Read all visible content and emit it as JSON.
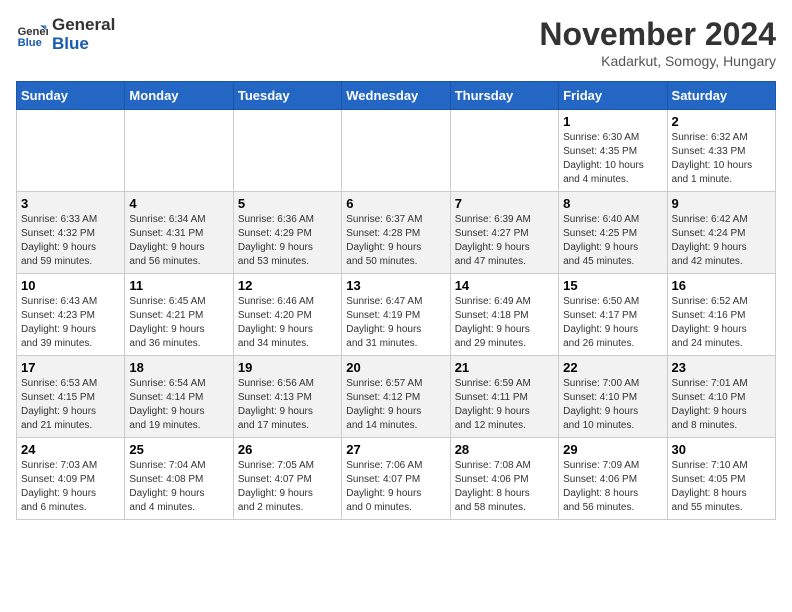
{
  "logo": {
    "line1": "General",
    "line2": "Blue"
  },
  "title": "November 2024",
  "subtitle": "Kadarkut, Somogy, Hungary",
  "headers": [
    "Sunday",
    "Monday",
    "Tuesday",
    "Wednesday",
    "Thursday",
    "Friday",
    "Saturday"
  ],
  "weeks": [
    [
      {
        "day": "",
        "detail": ""
      },
      {
        "day": "",
        "detail": ""
      },
      {
        "day": "",
        "detail": ""
      },
      {
        "day": "",
        "detail": ""
      },
      {
        "day": "",
        "detail": ""
      },
      {
        "day": "1",
        "detail": "Sunrise: 6:30 AM\nSunset: 4:35 PM\nDaylight: 10 hours\nand 4 minutes."
      },
      {
        "day": "2",
        "detail": "Sunrise: 6:32 AM\nSunset: 4:33 PM\nDaylight: 10 hours\nand 1 minute."
      }
    ],
    [
      {
        "day": "3",
        "detail": "Sunrise: 6:33 AM\nSunset: 4:32 PM\nDaylight: 9 hours\nand 59 minutes."
      },
      {
        "day": "4",
        "detail": "Sunrise: 6:34 AM\nSunset: 4:31 PM\nDaylight: 9 hours\nand 56 minutes."
      },
      {
        "day": "5",
        "detail": "Sunrise: 6:36 AM\nSunset: 4:29 PM\nDaylight: 9 hours\nand 53 minutes."
      },
      {
        "day": "6",
        "detail": "Sunrise: 6:37 AM\nSunset: 4:28 PM\nDaylight: 9 hours\nand 50 minutes."
      },
      {
        "day": "7",
        "detail": "Sunrise: 6:39 AM\nSunset: 4:27 PM\nDaylight: 9 hours\nand 47 minutes."
      },
      {
        "day": "8",
        "detail": "Sunrise: 6:40 AM\nSunset: 4:25 PM\nDaylight: 9 hours\nand 45 minutes."
      },
      {
        "day": "9",
        "detail": "Sunrise: 6:42 AM\nSunset: 4:24 PM\nDaylight: 9 hours\nand 42 minutes."
      }
    ],
    [
      {
        "day": "10",
        "detail": "Sunrise: 6:43 AM\nSunset: 4:23 PM\nDaylight: 9 hours\nand 39 minutes."
      },
      {
        "day": "11",
        "detail": "Sunrise: 6:45 AM\nSunset: 4:21 PM\nDaylight: 9 hours\nand 36 minutes."
      },
      {
        "day": "12",
        "detail": "Sunrise: 6:46 AM\nSunset: 4:20 PM\nDaylight: 9 hours\nand 34 minutes."
      },
      {
        "day": "13",
        "detail": "Sunrise: 6:47 AM\nSunset: 4:19 PM\nDaylight: 9 hours\nand 31 minutes."
      },
      {
        "day": "14",
        "detail": "Sunrise: 6:49 AM\nSunset: 4:18 PM\nDaylight: 9 hours\nand 29 minutes."
      },
      {
        "day": "15",
        "detail": "Sunrise: 6:50 AM\nSunset: 4:17 PM\nDaylight: 9 hours\nand 26 minutes."
      },
      {
        "day": "16",
        "detail": "Sunrise: 6:52 AM\nSunset: 4:16 PM\nDaylight: 9 hours\nand 24 minutes."
      }
    ],
    [
      {
        "day": "17",
        "detail": "Sunrise: 6:53 AM\nSunset: 4:15 PM\nDaylight: 9 hours\nand 21 minutes."
      },
      {
        "day": "18",
        "detail": "Sunrise: 6:54 AM\nSunset: 4:14 PM\nDaylight: 9 hours\nand 19 minutes."
      },
      {
        "day": "19",
        "detail": "Sunrise: 6:56 AM\nSunset: 4:13 PM\nDaylight: 9 hours\nand 17 minutes."
      },
      {
        "day": "20",
        "detail": "Sunrise: 6:57 AM\nSunset: 4:12 PM\nDaylight: 9 hours\nand 14 minutes."
      },
      {
        "day": "21",
        "detail": "Sunrise: 6:59 AM\nSunset: 4:11 PM\nDaylight: 9 hours\nand 12 minutes."
      },
      {
        "day": "22",
        "detail": "Sunrise: 7:00 AM\nSunset: 4:10 PM\nDaylight: 9 hours\nand 10 minutes."
      },
      {
        "day": "23",
        "detail": "Sunrise: 7:01 AM\nSunset: 4:10 PM\nDaylight: 9 hours\nand 8 minutes."
      }
    ],
    [
      {
        "day": "24",
        "detail": "Sunrise: 7:03 AM\nSunset: 4:09 PM\nDaylight: 9 hours\nand 6 minutes."
      },
      {
        "day": "25",
        "detail": "Sunrise: 7:04 AM\nSunset: 4:08 PM\nDaylight: 9 hours\nand 4 minutes."
      },
      {
        "day": "26",
        "detail": "Sunrise: 7:05 AM\nSunset: 4:07 PM\nDaylight: 9 hours\nand 2 minutes."
      },
      {
        "day": "27",
        "detail": "Sunrise: 7:06 AM\nSunset: 4:07 PM\nDaylight: 9 hours\nand 0 minutes."
      },
      {
        "day": "28",
        "detail": "Sunrise: 7:08 AM\nSunset: 4:06 PM\nDaylight: 8 hours\nand 58 minutes."
      },
      {
        "day": "29",
        "detail": "Sunrise: 7:09 AM\nSunset: 4:06 PM\nDaylight: 8 hours\nand 56 minutes."
      },
      {
        "day": "30",
        "detail": "Sunrise: 7:10 AM\nSunset: 4:05 PM\nDaylight: 8 hours\nand 55 minutes."
      }
    ]
  ]
}
